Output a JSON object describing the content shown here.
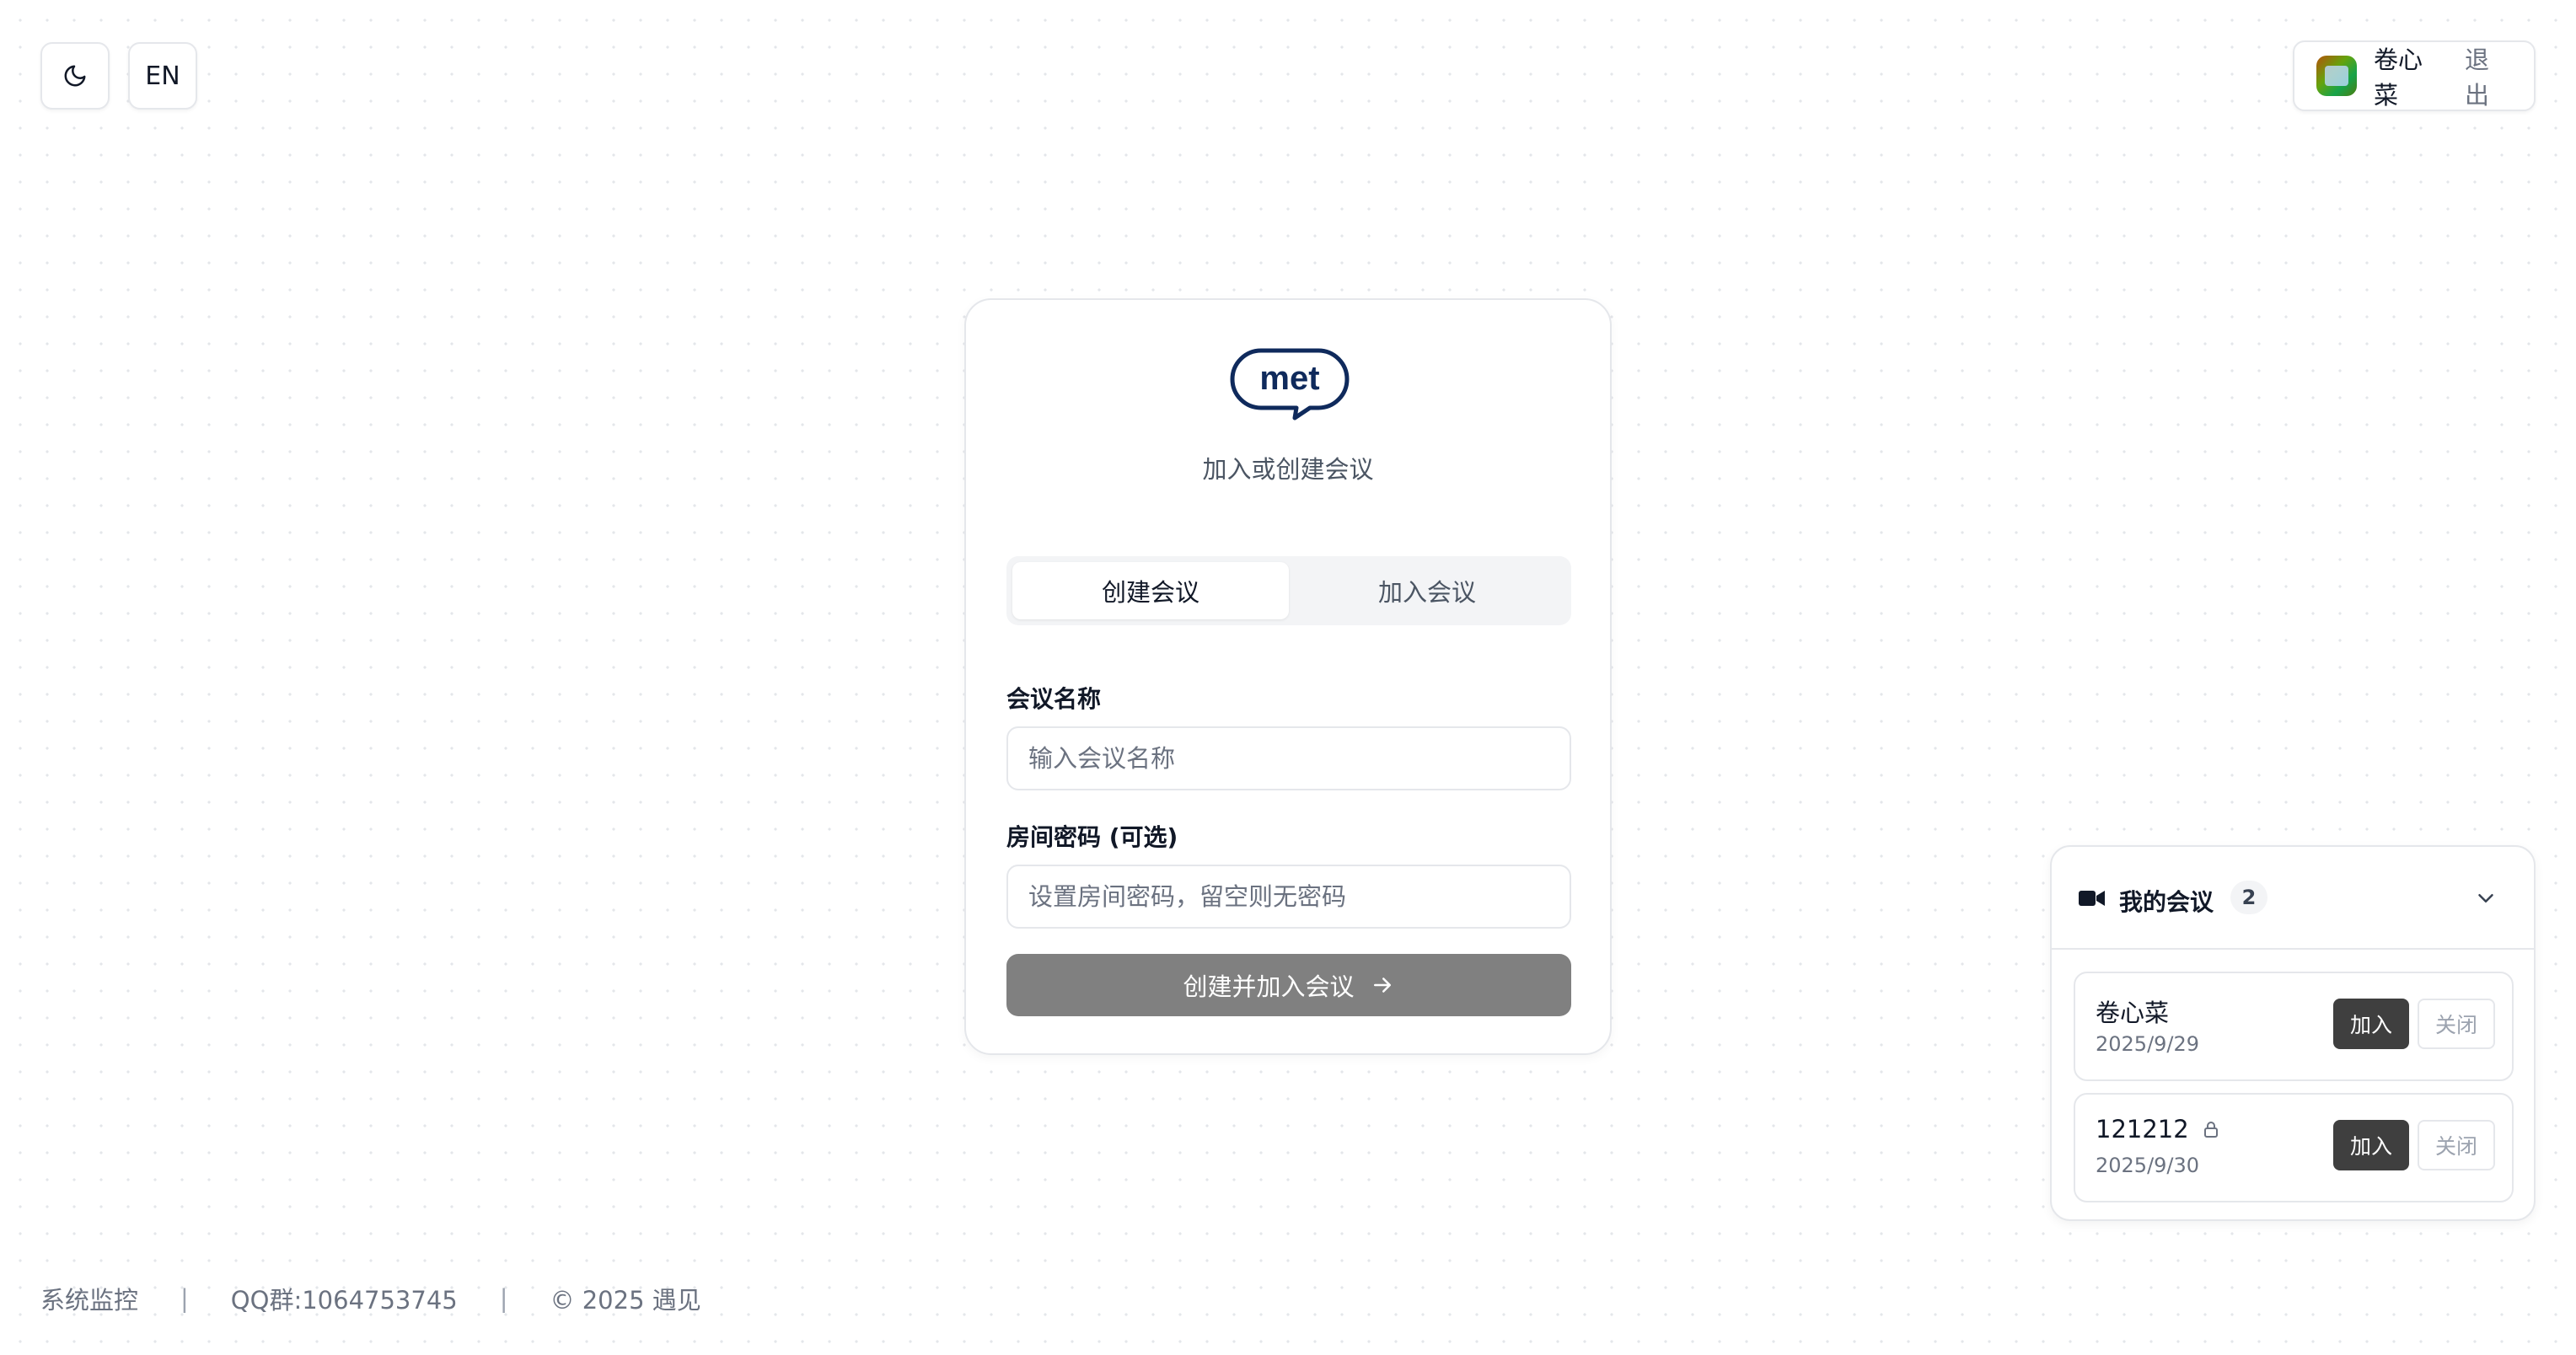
{
  "header": {
    "theme_icon": "moon-icon",
    "lang_label": "EN",
    "user": {
      "name": "卷心菜",
      "logout_label": "退出"
    }
  },
  "card": {
    "logo_text": "met",
    "subtitle": "加入或创建会议",
    "tabs": [
      {
        "label": "创建会议",
        "active": true
      },
      {
        "label": "加入会议",
        "active": false
      }
    ],
    "meeting_name_label": "会议名称",
    "meeting_name_placeholder": "输入会议名称",
    "meeting_name_value": "",
    "password_label": "房间密码 (可选)",
    "password_placeholder": "设置房间密码，留空则无密码",
    "password_value": "",
    "submit_label": "创建并加入会议",
    "logo_color": "#0f2a5c",
    "submit_color": "#808080"
  },
  "my_meetings": {
    "title": "我的会议",
    "count": "2",
    "meetings": [
      {
        "name": "卷心菜",
        "date": "2025/9/29",
        "locked": false,
        "join_label": "加入",
        "close_label": "关闭"
      },
      {
        "name": "121212",
        "date": "2025/9/30",
        "locked": true,
        "join_label": "加入",
        "close_label": "关闭"
      }
    ]
  },
  "footer": {
    "monitor": "系统监控",
    "qq": "QQ群:1064753745",
    "copyright": "© 2025 遇见",
    "separator": "|"
  }
}
